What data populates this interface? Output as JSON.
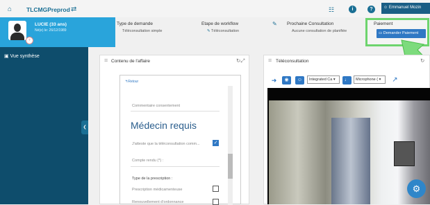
{
  "topbar": {
    "app_title": "TLCMGPreprod",
    "user_name": "Emmanuel Mozin",
    "icons": [
      "home-icon",
      "switch-icon",
      "grid-icon",
      "info-icon",
      "help-icon",
      "user-icon"
    ]
  },
  "patient": {
    "name": "LUCIE (33 ans)",
    "dob": "Né(e) le: 26/12/1989"
  },
  "header_info": {
    "type_demande_title": "Type de demande",
    "type_demande_value": "Téléconsultation simple",
    "workflow_title": "Etape de workflow",
    "workflow_value": "Téléconsultation",
    "consultation_title": "Prochaine Consultation",
    "consultation_value": "Aucune consultation de planifiée",
    "paiement_title": "Paiement",
    "paiement_button": "Demander Paiement"
  },
  "nav": {
    "vue_synthese": "Vue synthèse"
  },
  "contenu_panel": {
    "title": "Contenu de l'affaire",
    "retour": "Retour",
    "commentaire_label": "Commentaire consentement",
    "big_title": "Médecin requis",
    "attest_label": "J'atteste que la téléconsultation comm...",
    "compte_rendu_label": "Compte rendu (*) :",
    "type_prescription": "Type de la prescription :",
    "prescription_med": "Prescription médicamenteuse",
    "renouvellement": "Renouvellement d'ordonnance"
  },
  "teleconsult_panel": {
    "title": "Téléconsultation",
    "camera_select": "Integrated Ca",
    "microphone_select": "Microphone ("
  },
  "colors": {
    "brand": "#1a6f94",
    "patient_panel": "#29a4db",
    "nav": "#0e4d6c",
    "button": "#2f78c4",
    "highlight": "#6dd46d"
  }
}
